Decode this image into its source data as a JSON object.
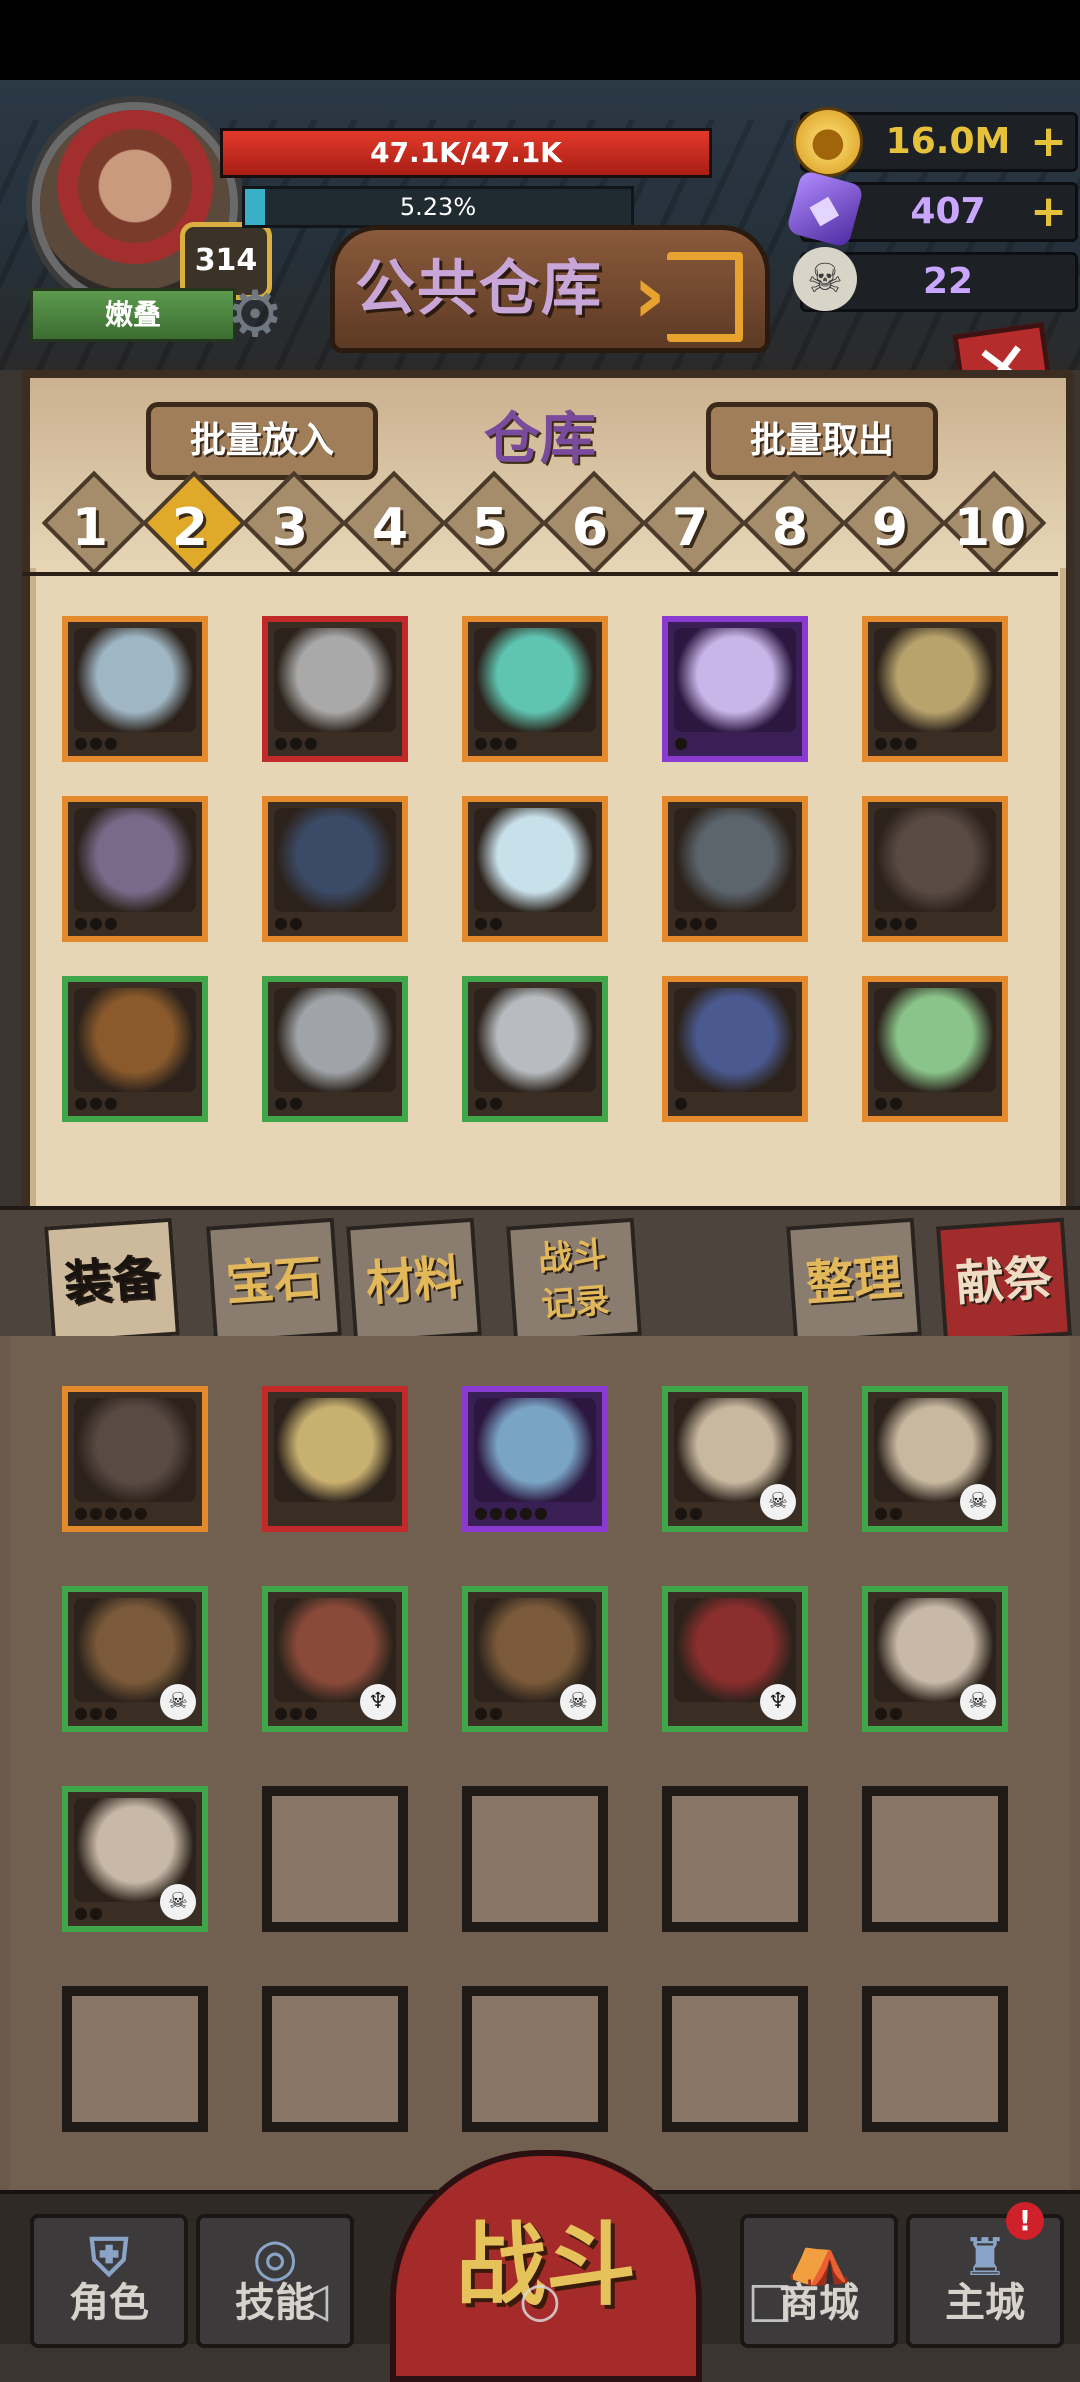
{
  "player": {
    "name": "嫩叠",
    "level": "314",
    "hp_text": "47.1K/47.1K",
    "hp_fraction": 1.0,
    "xp_text": "5.23%",
    "xp_fraction": 0.0523
  },
  "currencies": [
    {
      "icon": "gold-coin-icon",
      "value": "16.0M",
      "has_plus": true,
      "color": "#e6c13a"
    },
    {
      "icon": "purple-gem-icon",
      "value": "407",
      "has_plus": true,
      "color": "#c9a6ff"
    },
    {
      "icon": "ram-skull-icon",
      "value": "22",
      "has_plus": false,
      "color": "#c9a6ff"
    }
  ],
  "header": {
    "title": "公共仓库",
    "close_icon": "close-icon"
  },
  "storage": {
    "title": "仓库",
    "batch_put_label": "批量放入",
    "batch_take_label": "批量取出",
    "pages": [
      "1",
      "2",
      "3",
      "4",
      "5",
      "6",
      "7",
      "8",
      "9",
      "10"
    ],
    "active_page": "2",
    "items": [
      {
        "name": "ice-crystal-cluster-icon",
        "rarity": "orange",
        "color": "#9fb6c4",
        "dots": 3
      },
      {
        "name": "horned-helmet-icon",
        "rarity": "red",
        "color": "#a9a9a9",
        "dots": 3
      },
      {
        "name": "teal-gem-icon",
        "rarity": "orange",
        "color": "#5fc4b0",
        "dots": 3
      },
      {
        "name": "claw-icon",
        "rarity": "purple",
        "color": "#c8b6e8",
        "dots": 1
      },
      {
        "name": "scroll-icon",
        "rarity": "orange",
        "color": "#b8a36c",
        "dots": 3
      },
      {
        "name": "skull-shield-icon",
        "rarity": "orange",
        "color": "#7a6a8a",
        "dots": 3
      },
      {
        "name": "dragon-wing-icon",
        "rarity": "orange",
        "color": "#3b4a66",
        "dots": 2
      },
      {
        "name": "opal-stone-icon",
        "rarity": "orange",
        "color": "#c8e0ea",
        "dots": 2
      },
      {
        "name": "bandaged-wing-icon",
        "rarity": "orange",
        "color": "#5c646c",
        "dots": 3
      },
      {
        "name": "cracked-rock-icon",
        "rarity": "orange",
        "color": "#5a4a44",
        "dots": 3
      },
      {
        "name": "flame-belt-icon",
        "rarity": "green",
        "color": "#8a5a2c",
        "dots": 3
      },
      {
        "name": "armored-boots-icon",
        "rarity": "green",
        "color": "#a0a4a8",
        "dots": 2
      },
      {
        "name": "plate-armor-icon",
        "rarity": "green",
        "color": "#b8bcc0",
        "dots": 2
      },
      {
        "name": "cane-icon",
        "rarity": "orange",
        "color": "#4a5a90",
        "dots": 1
      },
      {
        "name": "green-tablet-icon",
        "rarity": "orange",
        "color": "#8ac48a",
        "dots": 2
      }
    ]
  },
  "lower_tabs": {
    "equipment": "装备",
    "gems": "宝石",
    "materials": "材料",
    "battle_log_line1": "战斗",
    "battle_log_line2": "记录",
    "sort": "整理",
    "sacrifice": "献祭"
  },
  "inventory": {
    "items": [
      {
        "name": "cracked-rock-icon",
        "rarity": "orange",
        "color": "#5a4a44",
        "dots": 5,
        "tag": ""
      },
      {
        "name": "crossed-swords-icon",
        "rarity": "red",
        "color": "#c8b070",
        "dots": 0,
        "tag": ""
      },
      {
        "name": "ornate-shield-icon",
        "rarity": "purple",
        "color": "#7aa4c4",
        "dots": 5,
        "tag": ""
      },
      {
        "name": "bone-claws-icon",
        "rarity": "green",
        "color": "#c8b8a0",
        "dots": 2,
        "tag": "skull"
      },
      {
        "name": "bone-claws-icon",
        "rarity": "green",
        "color": "#c8b8a0",
        "dots": 2,
        "tag": "skull"
      },
      {
        "name": "bone-skirt-icon",
        "rarity": "green",
        "color": "#7a5a3a",
        "dots": 3,
        "tag": "skull"
      },
      {
        "name": "bone-ribs-icon",
        "rarity": "green",
        "color": "#8a4a3a",
        "dots": 3,
        "tag": "horned"
      },
      {
        "name": "bone-skirt-icon",
        "rarity": "green",
        "color": "#7a5a3a",
        "dots": 2,
        "tag": "skull"
      },
      {
        "name": "red-spine-icon",
        "rarity": "green",
        "color": "#8a2e2e",
        "dots": 0,
        "tag": "horned"
      },
      {
        "name": "horned-skull-icon",
        "rarity": "green",
        "color": "#c8b8a8",
        "dots": 2,
        "tag": "skull"
      },
      {
        "name": "horned-skull-icon",
        "rarity": "green",
        "color": "#c8b8a8",
        "dots": 2,
        "tag": "skull"
      }
    ],
    "empty_slots": 9
  },
  "nav": {
    "role": "角色",
    "skill": "技能",
    "battle": "战斗",
    "shop": "商城",
    "main_city": "主城",
    "notification": "!"
  }
}
